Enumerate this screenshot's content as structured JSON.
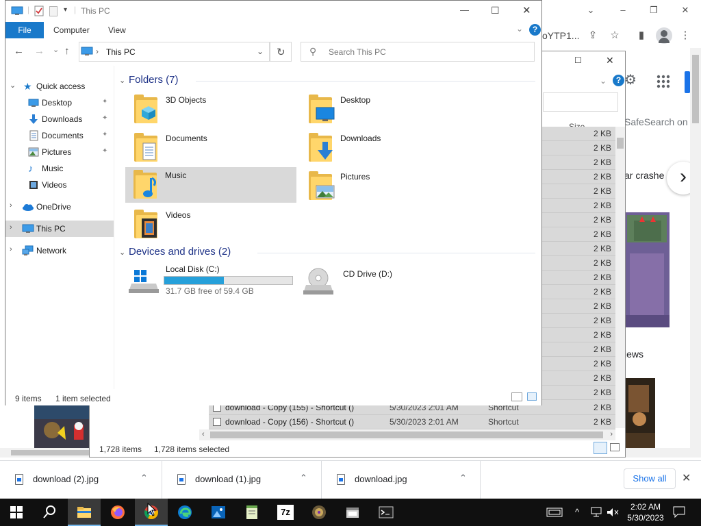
{
  "chrome": {
    "url_fragment": "oYTP1...",
    "safesearch_text": "SafeSearch on",
    "result_partial": "ar crashe",
    "news_partial": "iews",
    "minimize": "–",
    "maximize": "❐",
    "close": "✕",
    "dropdown": "⌄",
    "share": "⇪",
    "star": "☆",
    "sidebar": "▮",
    "menu": "⋮",
    "next": "›"
  },
  "downloads": {
    "items": [
      {
        "name": "download (2).jpg"
      },
      {
        "name": "download (1).jpg"
      },
      {
        "name": "download.jpg"
      }
    ],
    "show_all": "Show all",
    "close": "✕",
    "chevron": "⌃"
  },
  "explorer2": {
    "size_header": "Size",
    "rows": [
      {
        "size": "2 KB"
      },
      {
        "size": "2 KB"
      },
      {
        "size": "2 KB"
      },
      {
        "size": "2 KB"
      },
      {
        "size": "2 KB"
      },
      {
        "size": "2 KB"
      },
      {
        "size": "2 KB"
      },
      {
        "size": "2 KB"
      },
      {
        "size": "2 KB"
      },
      {
        "size": "2 KB"
      },
      {
        "size": "2 KB"
      },
      {
        "size": "2 KB"
      },
      {
        "size": "2 KB"
      },
      {
        "size": "2 KB"
      },
      {
        "size": "2 KB"
      },
      {
        "size": "2 KB"
      },
      {
        "size": "2 KB"
      },
      {
        "size": "2 KB"
      },
      {
        "size": "2 KB"
      },
      {
        "size": "2 KB"
      }
    ],
    "row_a": {
      "name": "download - Copy (155) - Shortcut ()",
      "date": "5/30/2023 2:01 AM",
      "type": "Shortcut",
      "size": "2 KB"
    },
    "row_b": {
      "name": "download - Copy (156) - Shortcut ()",
      "date": "5/30/2023 2:01 AM",
      "type": "Shortcut",
      "size": "2 KB"
    },
    "status_count": "1,728 items",
    "status_selected": "1,728 items selected",
    "close": "✕",
    "maximize": "☐",
    "help": "?"
  },
  "explorer": {
    "title": "This PC",
    "tabs": {
      "file": "File",
      "computer": "Computer",
      "view": "View"
    },
    "help": "?",
    "address": "This PC",
    "search_placeholder": "Search This PC",
    "nav": {
      "quick_access": "Quick access",
      "desktop": "Desktop",
      "downloads": "Downloads",
      "documents": "Documents",
      "pictures": "Pictures",
      "music": "Music",
      "videos": "Videos",
      "onedrive": "OneDrive",
      "this_pc": "This PC",
      "network": "Network"
    },
    "folders_header": "Folders (7)",
    "folders": {
      "objects3d": "3D Objects",
      "desktop": "Desktop",
      "documents": "Documents",
      "downloads": "Downloads",
      "music": "Music",
      "pictures": "Pictures",
      "videos": "Videos"
    },
    "devices_header": "Devices and drives (2)",
    "drives": {
      "c_name": "Local Disk (C:)",
      "c_free": "31.7 GB free of 59.4 GB",
      "c_used_fraction": 0.466,
      "d_name": "CD Drive (D:)"
    },
    "status": {
      "count": "9 items",
      "selected": "1 item selected"
    },
    "controls": {
      "minimize": "—",
      "maximize": "☐",
      "close": "✕",
      "back": "←",
      "forward": "→",
      "recent": "⌄",
      "up": "↑",
      "refresh": "↻",
      "dropdown": "⌄",
      "search_icon": "⚲",
      "pin": "✦"
    }
  },
  "taskbar": {
    "time": "2:02 AM",
    "date": "5/30/2023",
    "apps": [
      "start",
      "search",
      "file-explorer",
      "firefox",
      "chrome",
      "edge",
      "photos",
      "notepad",
      "7zip",
      "app-globe",
      "app-window",
      "terminal"
    ],
    "zip_label": "7z",
    "tray_up": "^",
    "notif": "▭"
  },
  "colors": {
    "accent": "#1979ca",
    "selection": "#cce8ff",
    "drive_fill": "#26a0da"
  }
}
